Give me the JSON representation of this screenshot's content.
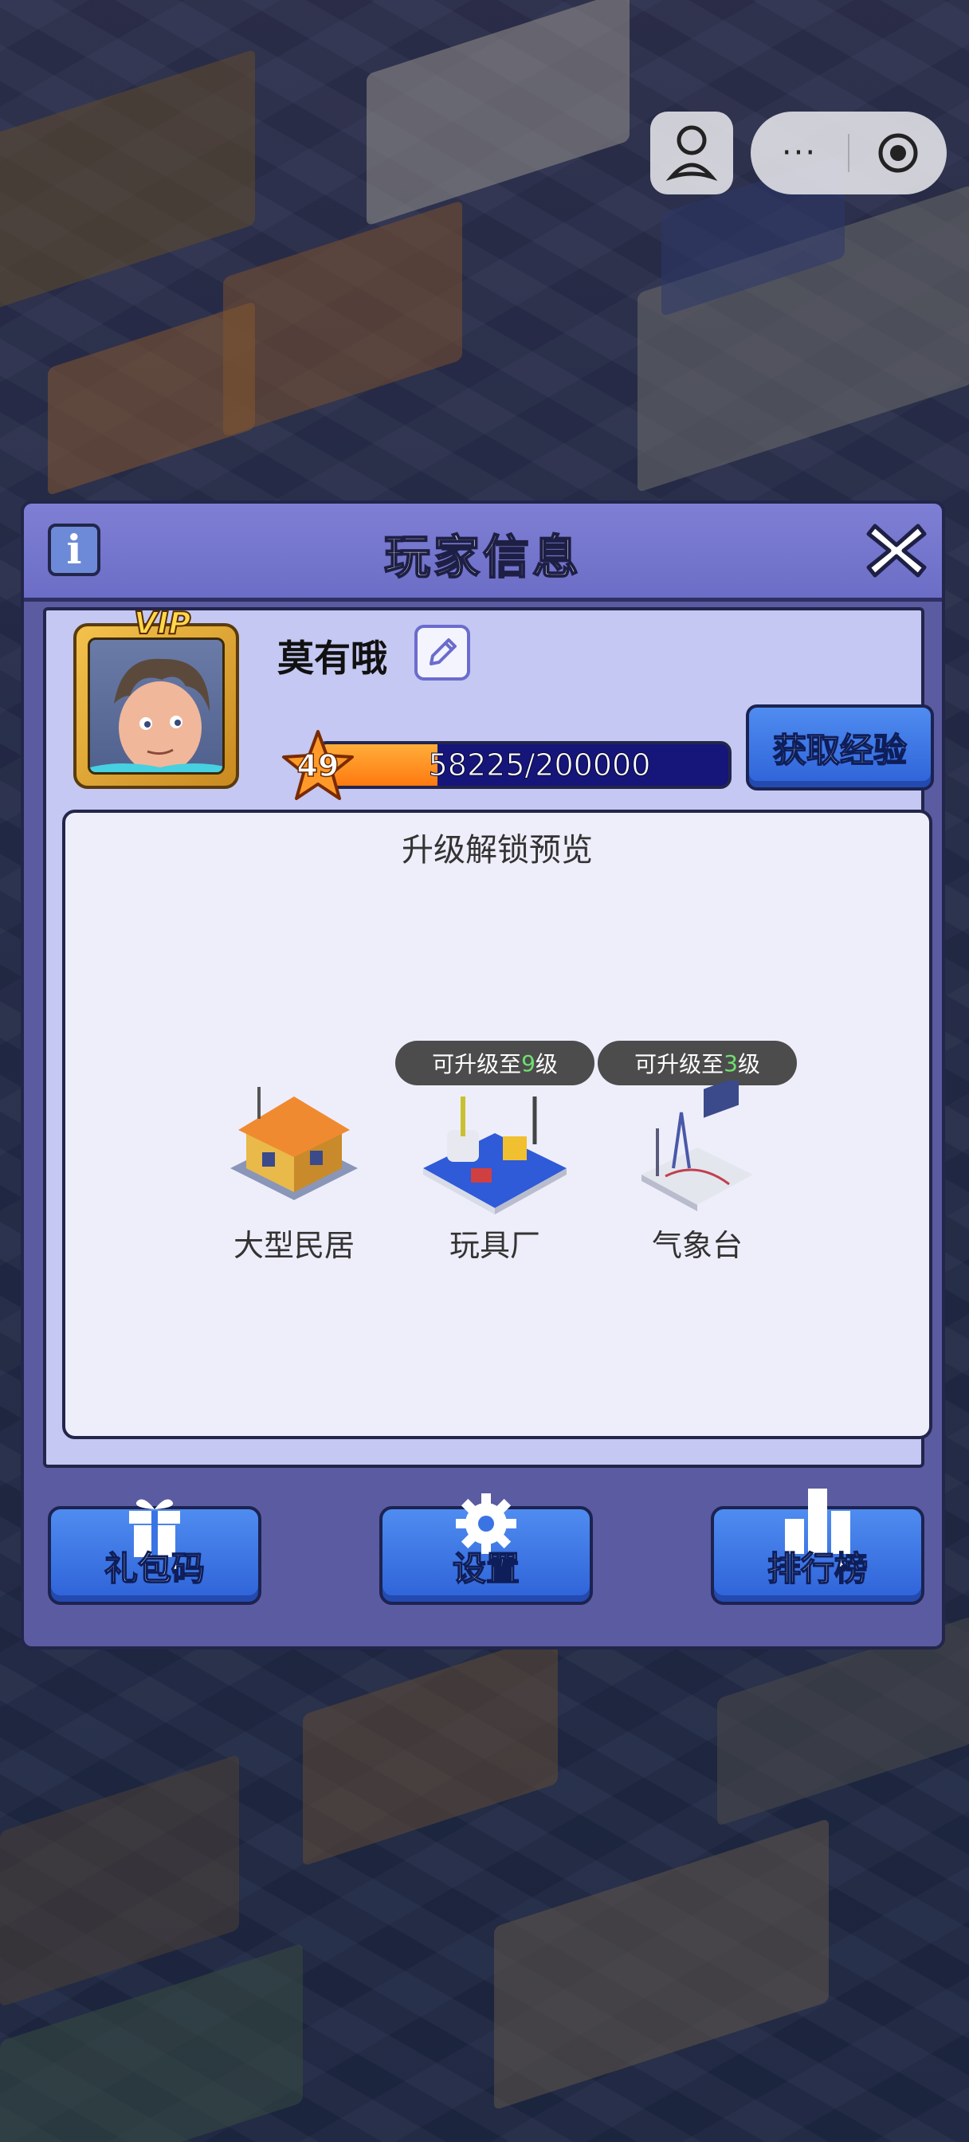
{
  "dialog": {
    "title": "玩家信息",
    "info_glyph": "i",
    "close_icon": "close-icon"
  },
  "player": {
    "badge": "VIP",
    "name": "莫有哦",
    "level": "49",
    "xp_text": "58225/200000",
    "xp_fraction": 0.29,
    "get_exp_label": "获取经验"
  },
  "preview": {
    "title": "升级解锁预览",
    "buildings": [
      {
        "name": "大型民居",
        "badge": null
      },
      {
        "name": "玩具厂",
        "badge": {
          "prefix": "可升级至",
          "level": "9",
          "suffix": "级"
        }
      },
      {
        "name": "气象台",
        "badge": {
          "prefix": "可升级至",
          "level": "3",
          "suffix": "级"
        }
      }
    ]
  },
  "actions": [
    {
      "label": "礼包码",
      "icon": "gift-icon"
    },
    {
      "label": "设置",
      "icon": "gear-icon"
    },
    {
      "label": "排行榜",
      "icon": "bar-chart-icon"
    }
  ],
  "capsule": {
    "more": "···"
  },
  "colors": {
    "accent_blue": "#2e62d8",
    "panel": "#5a5ba0",
    "header": "#7e7fd4",
    "badge_highlight": "#6fe06f"
  }
}
